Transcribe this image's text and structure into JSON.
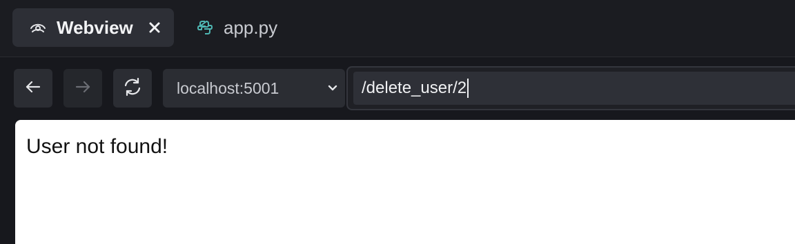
{
  "tabs": [
    {
      "label": "Webview",
      "icon": "webview-icon",
      "active": true,
      "close_icon": "close-icon"
    },
    {
      "label": "app.py",
      "icon": "python-icon",
      "active": false
    }
  ],
  "toolbar": {
    "back_icon": "arrow-left-icon",
    "forward_icon": "arrow-right-icon",
    "reload_icon": "reload-icon",
    "host": "localhost:5001",
    "host_dropdown_icon": "chevron-down-icon",
    "path": "/delete_user/2"
  },
  "page": {
    "message": "User not found!"
  },
  "colors": {
    "background": "#17181d",
    "tab_active": "#2d2f36",
    "python_icon": "#4fb7b3"
  }
}
